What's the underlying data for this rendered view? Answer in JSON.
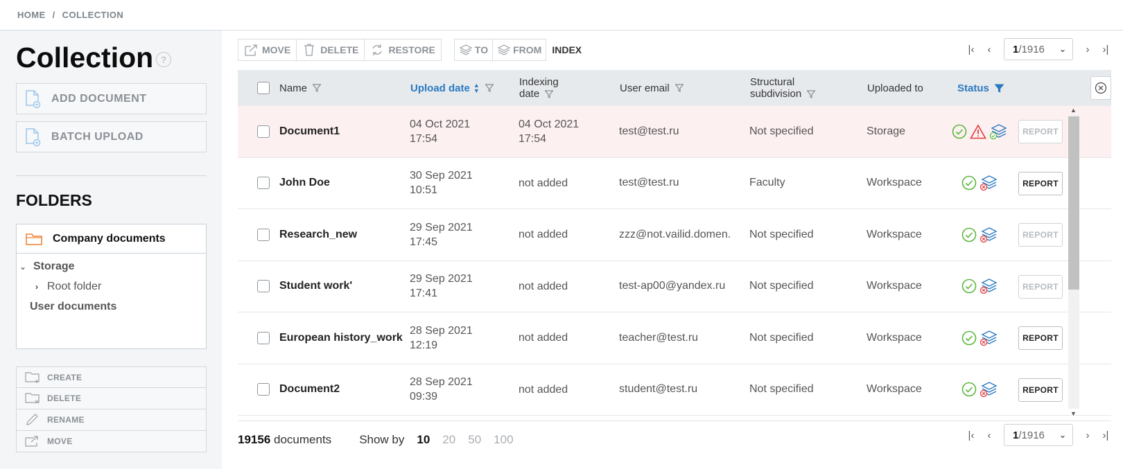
{
  "breadcrumb": [
    "HOME",
    "/",
    "COLLECTION"
  ],
  "sidebar": {
    "title": "Collection",
    "help_icon": "question-circle-icon",
    "add_document": "ADD DOCUMENT",
    "batch_upload": "BATCH UPLOAD",
    "folders_heading": "FOLDERS",
    "selected_folder": "Company documents",
    "tree": {
      "storage": "Storage",
      "root_folder": "Root folder",
      "user_documents": "User documents"
    },
    "folder_actions": [
      "CREATE",
      "DELETE",
      "RENAME",
      "MOVE"
    ]
  },
  "toolbar": {
    "move": "MOVE",
    "delete": "DELETE",
    "restore": "RESTORE",
    "to": "TO",
    "from": "FROM",
    "index": "INDEX"
  },
  "pager": {
    "current": "1",
    "total": "/1916"
  },
  "columns": {
    "name": "Name",
    "upload_date": "Upload date",
    "indexing_date_1": "Indexing",
    "indexing_date_2": "date",
    "user_email": "User email",
    "structural_1": "Structural",
    "structural_2": "subdivision",
    "uploaded_to": "Uploaded to",
    "status": "Status"
  },
  "rows": [
    {
      "name": "Document1",
      "upload_date": "04 Oct 2021",
      "upload_time": "17:54",
      "indexing_date": "04 Oct 2021",
      "indexing_time": "17:54",
      "email": "test@test.ru",
      "subdivision": "Not specified",
      "uploaded_to": "Storage",
      "report": "REPORT"
    },
    {
      "name": "John Doe",
      "upload_date": "30 Sep 2021",
      "upload_time": "10:51",
      "indexing_date": "not added",
      "indexing_time": "",
      "email": "test@test.ru",
      "subdivision": "Faculty",
      "uploaded_to": "Workspace",
      "report": "REPORT"
    },
    {
      "name": "Research_new",
      "upload_date": "29 Sep 2021",
      "upload_time": "17:45",
      "indexing_date": "not added",
      "indexing_time": "",
      "email": "zzz@not.vailid.domen.",
      "subdivision": "Not specified",
      "uploaded_to": "Workspace",
      "report": "REPORT"
    },
    {
      "name": "Student work'",
      "upload_date": "29 Sep 2021",
      "upload_time": "17:41",
      "indexing_date": "not added",
      "indexing_time": "",
      "email": "test-ap00@yandex.ru",
      "subdivision": "Not specified",
      "uploaded_to": "Workspace",
      "report": "REPORT"
    },
    {
      "name": "European history_work",
      "upload_date": "28 Sep 2021",
      "upload_time": "12:19",
      "indexing_date": "not added",
      "indexing_time": "",
      "email": "teacher@test.ru",
      "subdivision": "Not specified",
      "uploaded_to": "Workspace",
      "report": "REPORT"
    },
    {
      "name": "Document2",
      "upload_date": "28 Sep 2021",
      "upload_time": "09:39",
      "indexing_date": "not added",
      "indexing_time": "",
      "email": "student@test.ru",
      "subdivision": "Not specified",
      "uploaded_to": "Workspace",
      "report": "REPORT"
    }
  ],
  "footer": {
    "count": "19156",
    "count_label": "documents",
    "show_by": "Show by",
    "options": [
      "10",
      "20",
      "50",
      "100"
    ]
  },
  "colors": {
    "accent_blue": "#2a79c1",
    "ok_green": "#59b73a",
    "warn_red": "#e23b3b",
    "warn_row_bg": "#fdf0f1",
    "orange_folder": "#f08234"
  }
}
